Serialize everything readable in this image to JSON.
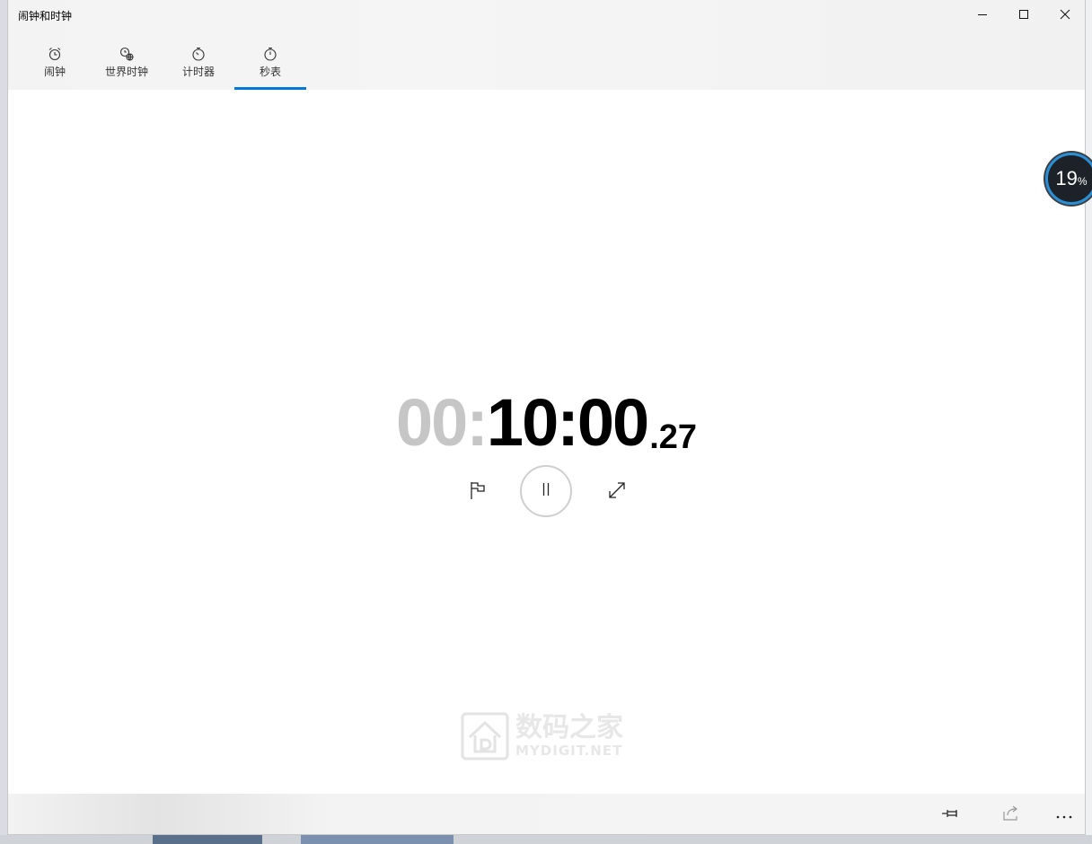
{
  "window": {
    "title": "闹钟和时钟",
    "minimize_icon": "minimize-icon",
    "maximize_icon": "maximize-icon",
    "close_icon": "close-icon"
  },
  "tabs": [
    {
      "label": "闹钟",
      "icon": "alarm-clock-icon",
      "active": false
    },
    {
      "label": "世界时钟",
      "icon": "world-clock-icon",
      "active": false
    },
    {
      "label": "计时器",
      "icon": "timer-icon",
      "active": false
    },
    {
      "label": "秒表",
      "icon": "stopwatch-icon",
      "active": true
    }
  ],
  "stopwatch": {
    "hours": "00:",
    "minutes_seconds": "10:00",
    "fraction": ".27",
    "controls": {
      "lap_icon": "flag-icon",
      "pause_icon": "pause-icon",
      "expand_icon": "expand-icon"
    }
  },
  "watermark": {
    "cn": "数码之家",
    "en": "MYDIGIT.NET"
  },
  "bottom_bar": {
    "pin_icon": "pin-icon",
    "share_icon": "share-icon",
    "more_icon": "more-icon"
  },
  "overlay_badge": {
    "value": "19",
    "unit": "%"
  },
  "colors": {
    "accent": "#0078d7",
    "dim_digits": "#c6c6c6",
    "main_digits": "#000000"
  }
}
